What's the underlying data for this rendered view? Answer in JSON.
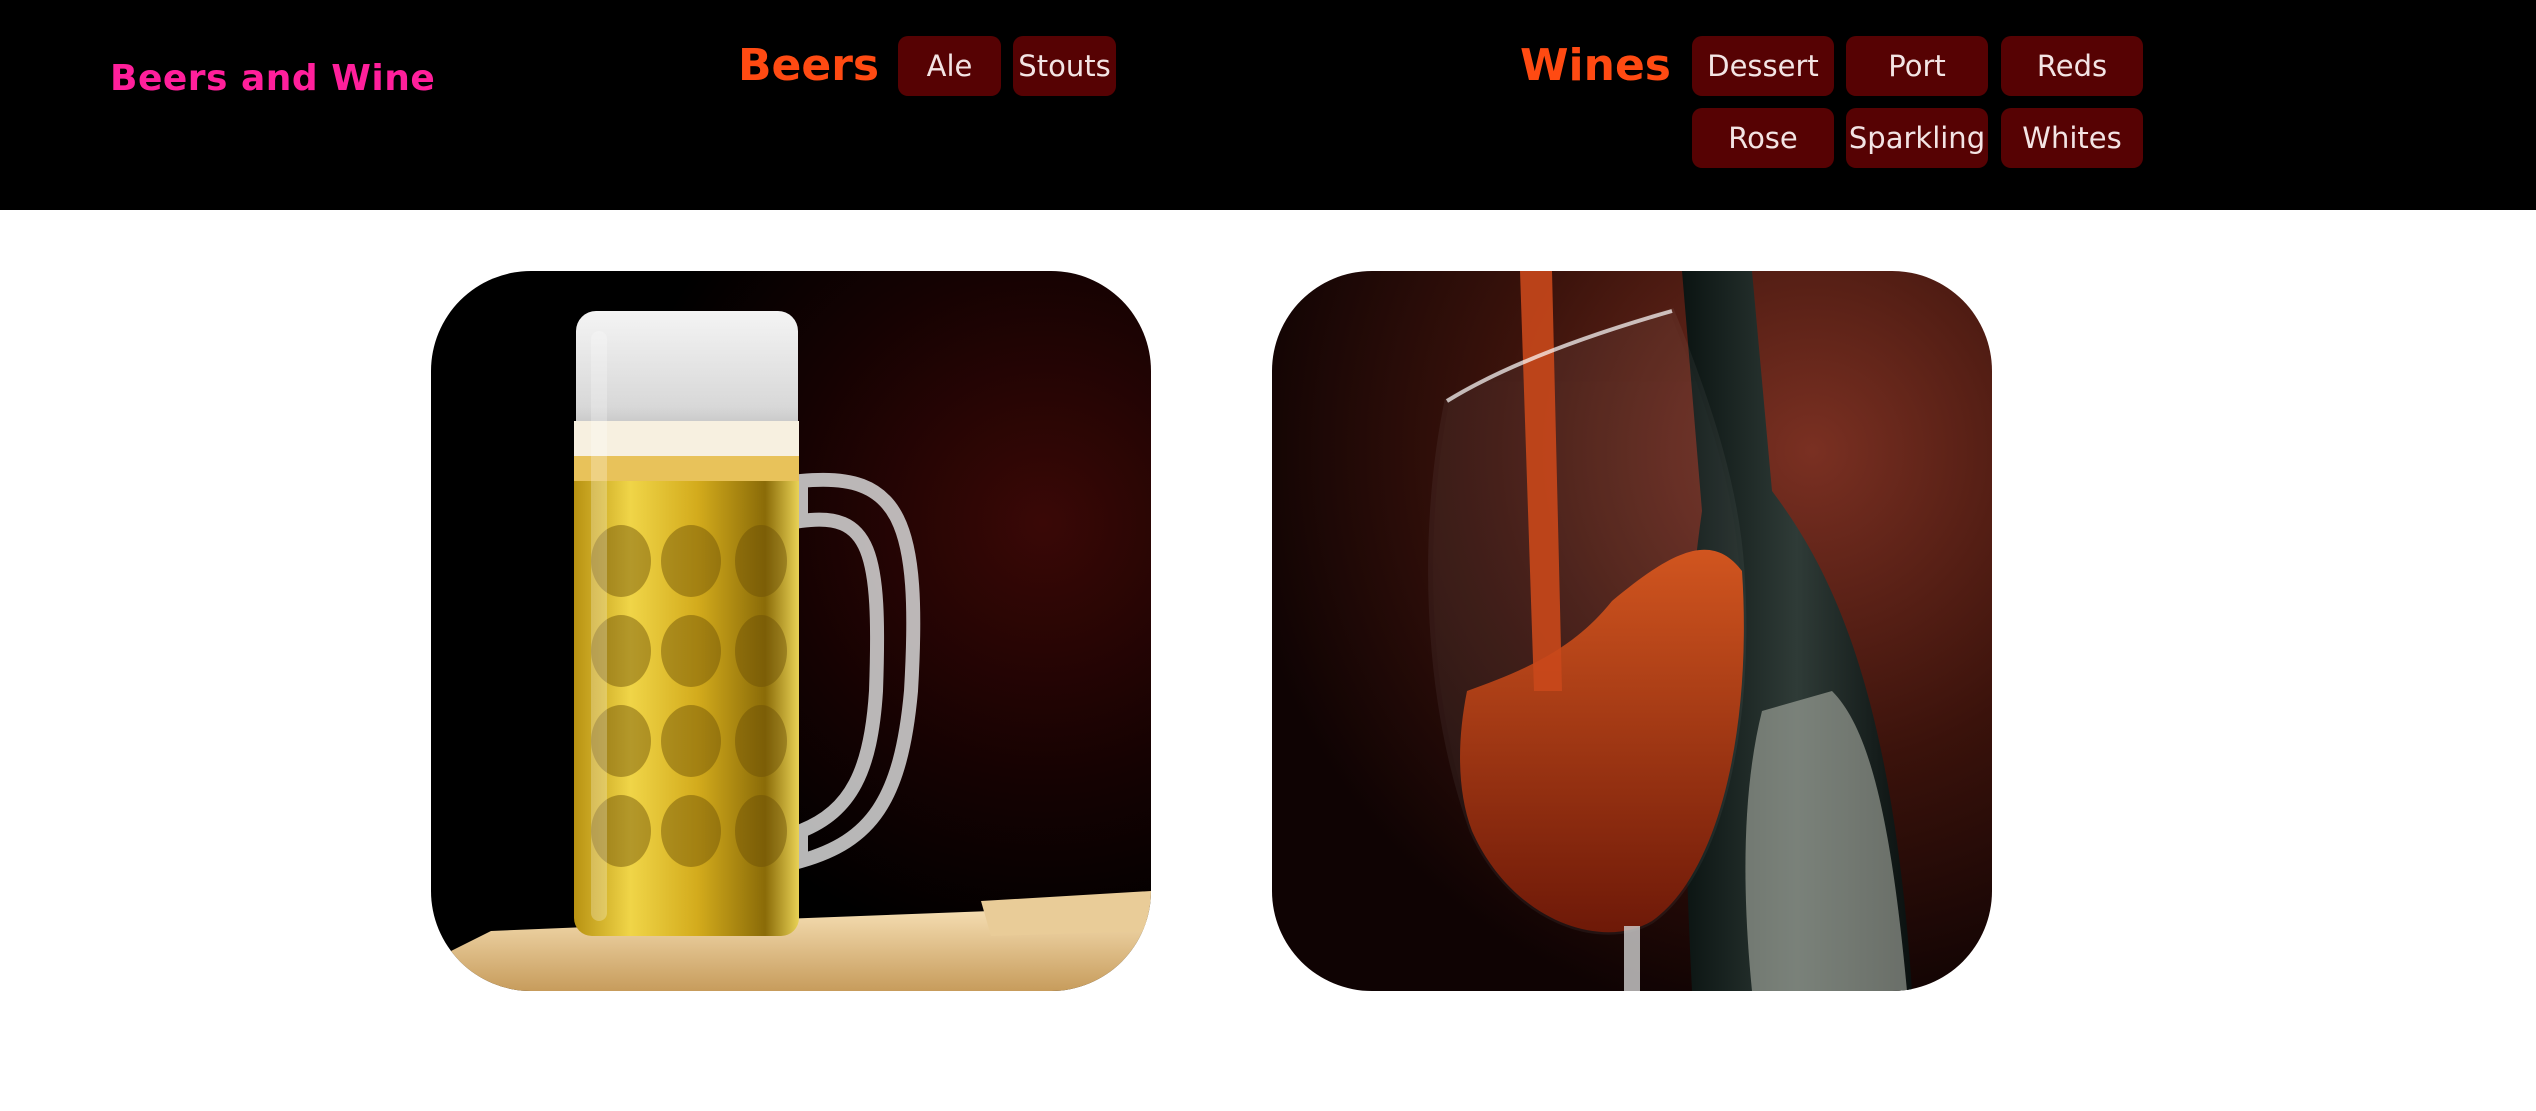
{
  "colors": {
    "header_bg": "#000000",
    "brand": "#ff1f9b",
    "section_title": "#ff4a12",
    "button_bg": "#560203",
    "button_text": "#f3e4e4",
    "page_bg": "#ffffff"
  },
  "brand": {
    "title": "Beers and Wine"
  },
  "beers": {
    "title": "Beers",
    "items": [
      {
        "label": "Ale"
      },
      {
        "label": "Stouts"
      }
    ]
  },
  "wines": {
    "title": "Wines",
    "items": [
      {
        "label": "Dessert"
      },
      {
        "label": "Port"
      },
      {
        "label": "Reds"
      },
      {
        "label": "Rose"
      },
      {
        "label": "Sparkling"
      },
      {
        "label": "Whites"
      }
    ]
  },
  "images": [
    {
      "subject": "beer-mug-photo"
    },
    {
      "subject": "wine-glass-pour-photo"
    }
  ]
}
